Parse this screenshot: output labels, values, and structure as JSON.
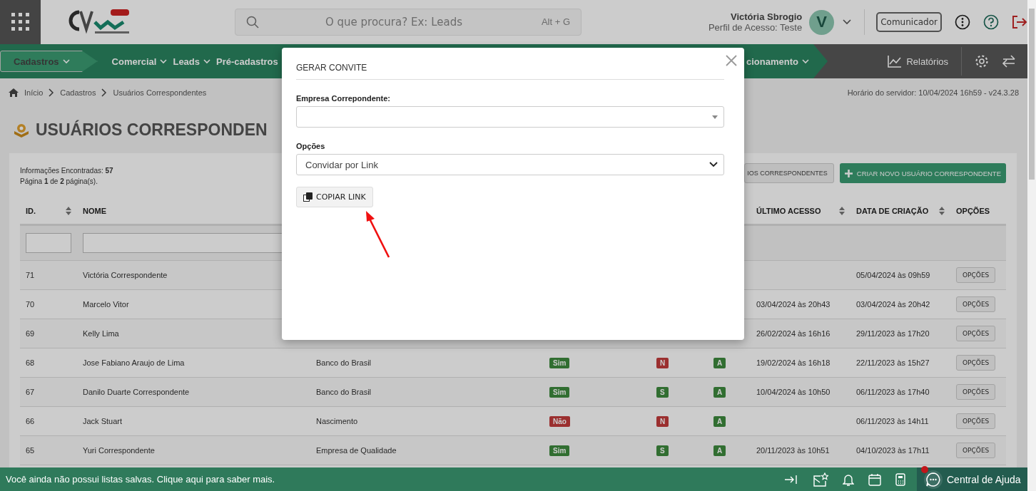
{
  "header": {
    "search_placeholder": "O que procura? Ex: Leads",
    "search_shortcut": "Alt + G",
    "user_name": "Victória Sbrogio",
    "user_profile": "Perfil de Acesso: Teste",
    "avatar_initial": "V",
    "communicator_button": "Comunicador"
  },
  "nav": {
    "items": [
      {
        "label": "Cadastros",
        "selected": true,
        "dropdown": true
      },
      {
        "label": "Comercial",
        "selected": false,
        "dropdown": true
      },
      {
        "label": "Leads",
        "selected": false,
        "dropdown": true
      },
      {
        "label": "Pré-cadastros",
        "selected": false,
        "dropdown": false
      },
      {
        "label": "cionamento",
        "selected": false,
        "dropdown": true
      }
    ],
    "reports": "Relatórios"
  },
  "breadcrumb": [
    "Início",
    "Cadastros",
    "Usuários Correspondentes"
  ],
  "server_time": "Horário do servidor: 10/04/2024 16h59 - v24.3.28",
  "page_title": "USUÁRIOS CORRESPONDEN",
  "summary": {
    "found_text": "Informações Encontradas: **57**",
    "page_text": "Página **1** de **2** página(s)."
  },
  "buttons": [
    {
      "label": "IOS CORRESPONDENTES",
      "kind": "secondary"
    },
    {
      "label": "CRIAR NOVO USUÁRIO CORRESPONDENTE",
      "kind": "primary"
    }
  ],
  "table": {
    "columns": [
      {
        "label": "ID.",
        "sortable": true
      },
      {
        "label": "NOME",
        "sortable": false
      },
      {
        "label": "ÚLTIMO ACESSO",
        "sortable": true
      },
      {
        "label": "DATA DE CRIAÇÃO",
        "sortable": true
      },
      {
        "label": "OPÇÕES",
        "sortable": false
      }
    ],
    "rows": [
      {
        "id": "71",
        "name": "Victória Correspondente",
        "created": "05/04/2024 às 09h59",
        "options": "OPÇÕES"
      },
      {
        "id": "70",
        "name": "Marcelo Vitor",
        "last_access": "03/04/2024 às 20h43",
        "created": "03/04/2024 às 20h42",
        "options": "OPÇÕES"
      },
      {
        "id": "69",
        "name": "Kelly Lima",
        "last_access": "26/02/2024 às 16h16",
        "created": "29/11/2023 às 17h20",
        "options": "OPÇÕES"
      },
      {
        "id": "68",
        "name": "Jose Fabiano Araujo de Lima",
        "company": "Banco do Brasil",
        "column_4": {
          "text": "Sim",
          "positive": true
        },
        "column_5": {
          "text": "N",
          "positive": false
        },
        "column_6": {
          "text": "A",
          "positive": true
        },
        "last_access": "19/02/2024 às 16h18",
        "created": "22/11/2023 às 15h27",
        "options": "OPÇÕES"
      },
      {
        "id": "67",
        "name": "Danilo Duarte Correspondente",
        "company": "Banco do Brasil",
        "column_4": {
          "text": "Sim",
          "positive": true
        },
        "column_5": {
          "text": "S",
          "positive": true
        },
        "column_6": {
          "text": "A",
          "positive": true
        },
        "last_access": "10/04/2024 às 10h50",
        "created": "06/11/2023 às 17h40",
        "options": "OPÇÕES"
      },
      {
        "id": "66",
        "name": "Jack Stuart",
        "company": "Nascimento",
        "column_4": {
          "text": "Não",
          "positive": false
        },
        "column_5": {
          "text": "N",
          "positive": false
        },
        "column_6": {
          "text": "A",
          "positive": true
        },
        "created": "06/11/2023 às 14h11",
        "options": "OPÇÕES"
      },
      {
        "id": "65",
        "name": "Yuri Correspondente",
        "company": "Empresa de Qualidade",
        "column_4": {
          "text": "Sim",
          "positive": true
        },
        "column_5": {
          "text": "S",
          "positive": true
        },
        "column_6": {
          "text": "A",
          "positive": true
        },
        "last_access": "20/11/2023 às 10h51",
        "created": "04/10/2023 às 17h11",
        "options": "OPÇÕES"
      }
    ]
  },
  "modal": {
    "title": "GERAR CONVITE",
    "fields": [
      {
        "label": "Empresa Correpondente:",
        "kind": "combobox"
      },
      {
        "label": "Opções",
        "kind": "select",
        "value": "Convidar por Link"
      }
    ],
    "copy_button": "COPIAR LINK"
  },
  "status_bar": {
    "message": "Você ainda não possui listas salvas. Clique aqui para saber mais.",
    "help": "Central de Ajuda",
    "help_notification": true
  }
}
